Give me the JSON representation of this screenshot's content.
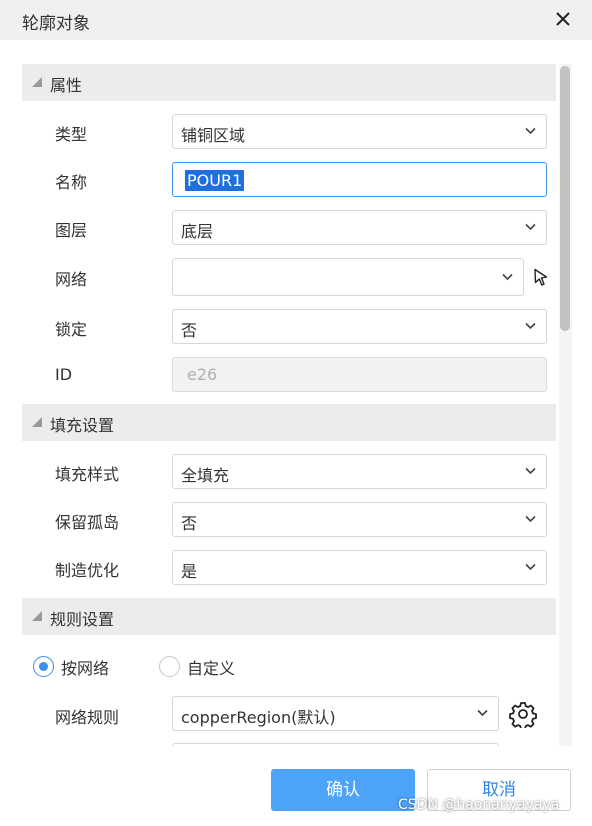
{
  "dialog": {
    "title": "轮廓对象"
  },
  "sections": {
    "properties": "属性",
    "fill_settings": "填充设置",
    "rule_settings": "规则设置"
  },
  "fields": {
    "type": {
      "label": "类型",
      "value": "铺铜区域"
    },
    "name": {
      "label": "名称",
      "value": "POUR1"
    },
    "layer": {
      "label": "图层",
      "value": "底层"
    },
    "net": {
      "label": "网络",
      "value": ""
    },
    "lock": {
      "label": "锁定",
      "value": "否"
    },
    "id": {
      "label": "ID",
      "value": "e26"
    },
    "fill_style": {
      "label": "填充样式",
      "value": "全填充"
    },
    "keep_islands": {
      "label": "保留孤岛",
      "value": "否"
    },
    "mfg_optimize": {
      "label": "制造优化",
      "value": "是"
    },
    "net_rule": {
      "label": "网络规则",
      "value": "copperRegion(默认)"
    }
  },
  "rule_mode": {
    "options": [
      "按网络",
      "自定义"
    ],
    "selected": "按网络"
  },
  "buttons": {
    "ok": "确认",
    "cancel": "取消"
  },
  "watermark": "CSDN @haonanyayaya",
  "colors": {
    "accent": "#3b8fe6",
    "primary_button": "#4da3f7",
    "selection": "#1e6fe0"
  },
  "icons": [
    "close-icon",
    "collapse-triangle-icon",
    "chevron-down-icon",
    "pointer-pick-icon",
    "gear-icon"
  ]
}
